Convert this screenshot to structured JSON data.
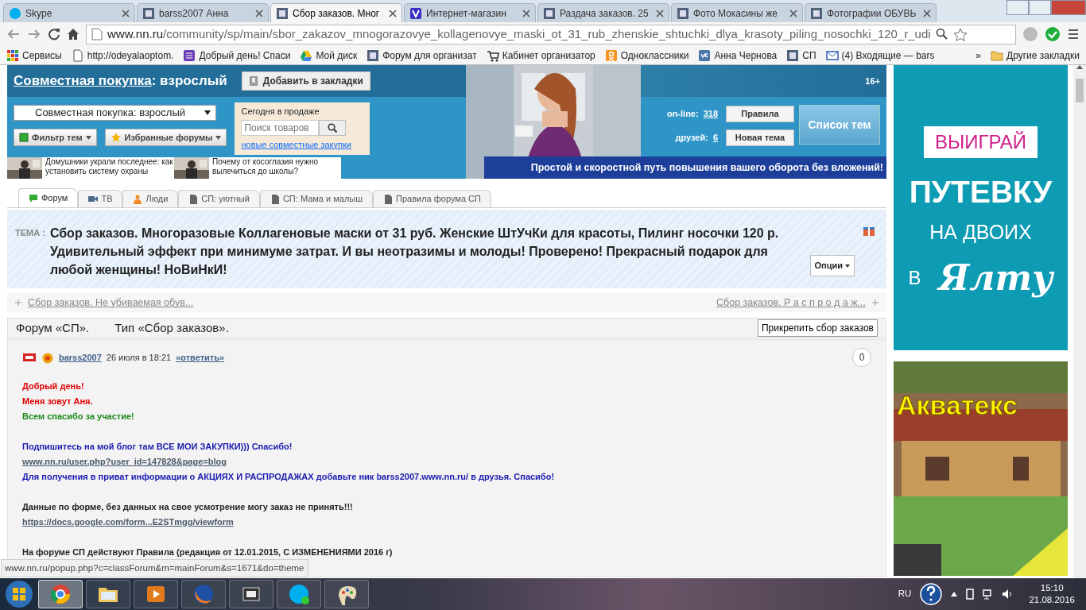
{
  "browser": {
    "tabs": [
      {
        "title": "Skype",
        "kind": "skype",
        "selected": false
      },
      {
        "title": "barss2007 Анна",
        "kind": "nn",
        "selected": false
      },
      {
        "title": "Сбор заказов. Мног",
        "kind": "nn",
        "selected": true
      },
      {
        "title": "Интернет-магазин",
        "kind": "v",
        "selected": false
      },
      {
        "title": "Раздача заказов. 25",
        "kind": "nn",
        "selected": false
      },
      {
        "title": "Фото Мокасины же",
        "kind": "nn",
        "selected": false
      },
      {
        "title": "Фотографии ОБУВЬ",
        "kind": "nn",
        "selected": false
      }
    ],
    "address": "www.nn.ru/community/sp/main/sbor_zakazov_mnogorazovye_kollagenovye_maski_ot_31_rub_zhenskie_shtuchki_dlya_krasoty_piling_nosochki_120_r_udi",
    "bookmarks": [
      {
        "label": "Сервисы",
        "kind": "apps"
      },
      {
        "label": "http://odeyalaoptom.",
        "kind": "page"
      },
      {
        "label": "Добрый день! Спаси",
        "kind": "list"
      },
      {
        "label": "Мой диск",
        "kind": "drive"
      },
      {
        "label": "Форум для организат",
        "kind": "nn"
      },
      {
        "label": "Кабинет организатор",
        "kind": "cart"
      },
      {
        "label": "Одноклассники",
        "kind": "ok"
      },
      {
        "label": "Анна Чернова",
        "kind": "vk"
      },
      {
        "label": "СП",
        "kind": "nn"
      },
      {
        "label": "(4) Входящие — bars",
        "kind": "mail"
      }
    ],
    "more": "»",
    "other_bookmarks": "Другие закладки"
  },
  "header": {
    "title_link": "Совместная покупка",
    "title_rest": ": взрослый",
    "bookmark_button": "Добавить в закладки",
    "age": "16+",
    "section_select": "Совместная покупка: взрослый",
    "filter_button": "Фильтр тем",
    "favorites_button": "Избранные форумы",
    "sale_box": {
      "title": "Сегодня в продаже",
      "placeholder": "Поиск товаров",
      "link": "новые совместные закупки"
    },
    "stats": [
      {
        "label": "on-line:",
        "value": "318"
      },
      {
        "label": "друзей:",
        "value": "6"
      }
    ],
    "buttons": [
      "Правила",
      "Новая тема"
    ],
    "topics_button": "Список тем",
    "banner": "Простой и скоростной путь повышения вашего оборота без вложений!",
    "news": [
      "Домушники украли последнее: как установить систему охраны",
      "Почему от косоглазия нужно вылечиться до школы?"
    ]
  },
  "forum_tabs": [
    {
      "label": "Форум",
      "kind": "chat",
      "selected": true
    },
    {
      "label": "ТВ",
      "kind": "tv",
      "selected": false
    },
    {
      "label": "Люди",
      "kind": "people",
      "selected": false
    },
    {
      "label": "СП: уютный",
      "kind": "doc",
      "selected": false
    },
    {
      "label": "СП: Мама и малыш",
      "kind": "doc",
      "selected": false
    },
    {
      "label": "Правила форума СП",
      "kind": "doc",
      "selected": false
    }
  ],
  "topic": {
    "label": "ТЕМА :",
    "title": "Сбор заказов. Многоразовые Коллагеновые маски от 31 руб. Женские ШтУчКи для красоты, Пилинг носочки 120 р. Удивительный эффект при минимуме затрат. И вы неотразимы и молоды! Проверено! Прекрасный подарок для любой женщины! НоВиНкИ!",
    "options": "Опции"
  },
  "topic_nav": {
    "previous": "Сбор заказов. Не убиваемая обув...",
    "next": "Сбор заказов. Р а с п р о д а ж..."
  },
  "forum_bar": {
    "forum": "Форум «СП».",
    "type": "Тип «Сбор заказов».",
    "pin_button": "Прикрепить сбор заказов"
  },
  "post": {
    "author": "barss2007",
    "date": "26 июля в 18:21",
    "reply": "«ответить»",
    "count": "0",
    "lines": [
      {
        "text": "Добрый день!",
        "kind": "text",
        "color": "#e00000",
        "gap": false
      },
      {
        "text": "Меня зовут Аня.",
        "kind": "text",
        "color": "#e00000",
        "gap": false
      },
      {
        "text": "Всем спасибо за участие!",
        "kind": "text",
        "color": "#1a8a1a",
        "gap": false
      },
      {
        "text": "Подпишитесь на мой блог там ВСЕ МОИ ЗАКУПКИ))) Спасибо!",
        "kind": "text",
        "color": "#1a1ab0",
        "gap": true
      },
      {
        "text": "www.nn.ru/user.php?user_id=147828&page=blog",
        "kind": "link",
        "color": "#4a5a6a",
        "gap": false
      },
      {
        "text": "Для получения в приват информации о АКЦИЯХ И РАСПРОДАЖАХ добавьте ник barss2007.www.nn.ru/ в друзья. Спасибо!",
        "kind": "text",
        "color": "#1a1ab0",
        "gap": false
      },
      {
        "text": "Данные по форме, без данных на свое усмотрение могу заказ не принять!!!",
        "kind": "text",
        "color": "#222222",
        "gap": true
      },
      {
        "text": "https://docs.google.com/form...E2STmgg/viewform",
        "kind": "link",
        "color": "#4a5a6a",
        "gap": false
      },
      {
        "text": "На форуме СП действуют Правила (редакция от 12.01.2015, С ИЗМЕНЕНИЯМИ 2016 г)",
        "kind": "text",
        "color": "#222222",
        "gap": true
      }
    ]
  },
  "status_url": "www.nn.ru/popup.php?c=classForum&m=mainForum&s=1671&do=theme",
  "ads": {
    "badge": "ВЫИГРАЙ",
    "headline": "ПУТЕВКУ",
    "sub": "НА ДВОИХ",
    "prep": "В",
    "place": "Ялту",
    "brand": "Акватекс"
  },
  "taskbar": {
    "apps": [
      {
        "kind": "chrome",
        "selected": true
      },
      {
        "kind": "folder",
        "selected": false
      },
      {
        "kind": "player",
        "selected": false
      },
      {
        "kind": "firefox",
        "selected": false
      },
      {
        "kind": "film",
        "selected": false
      },
      {
        "kind": "skype",
        "selected": false
      },
      {
        "kind": "paint",
        "selected": false
      }
    ],
    "lang": "RU",
    "time": "15:10",
    "date": "21.08.2016"
  }
}
